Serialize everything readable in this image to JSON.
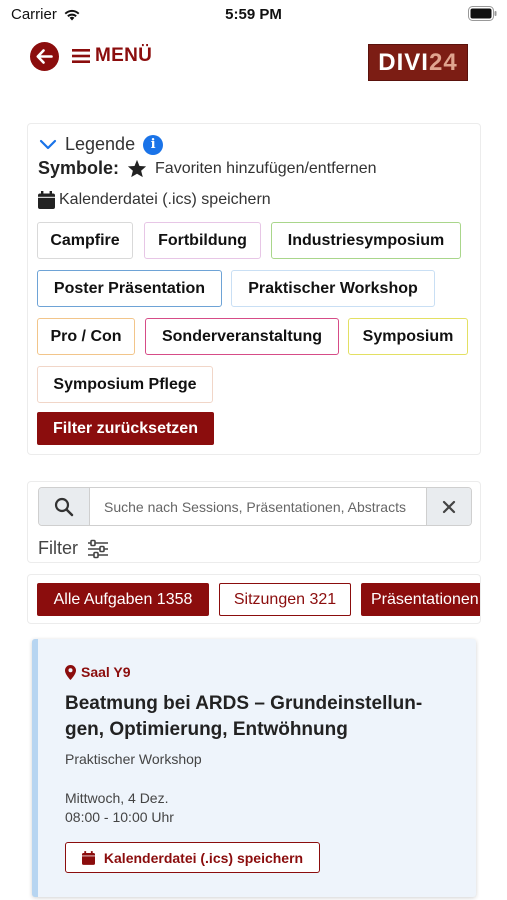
{
  "status_bar": {
    "carrier": "Carrier",
    "time": "5:59 PM"
  },
  "header": {
    "menu_label": "MENÜ",
    "logo_text_1": "DIVI",
    "logo_text_2": "24"
  },
  "legend": {
    "title": "Legende",
    "symbols_label": "Symbole:",
    "favorite_text": "Favoriten hinzufügen/entfernen",
    "calendar_text": "Kalenderdatei (.ics) speichern",
    "tags": [
      {
        "label": "Campfire",
        "color": "#d9d9d9"
      },
      {
        "label": "Fortbildung",
        "color": "#e7c6e6"
      },
      {
        "label": "Industriesymposium",
        "color": "#a9d68b"
      },
      {
        "label": "Poster Präsentation",
        "color": "#6ea3d6"
      },
      {
        "label": "Praktischer Workshop",
        "color": "#c9dff4"
      },
      {
        "label": "Pro / Con",
        "color": "#f2c58a"
      },
      {
        "label": "Sonderveranstaltung",
        "color": "#d64c87"
      },
      {
        "label": "Symposium",
        "color": "#e3e063"
      },
      {
        "label": "Symposium Pflege",
        "color": "#f1d6c8"
      }
    ],
    "reset_label": "Filter zurücksetzen"
  },
  "search": {
    "placeholder": "Suche nach Sessions, Präsentationen, Abstracts",
    "value": "",
    "filter_label": "Filter"
  },
  "tabs": [
    {
      "label": "Alle Aufgaben 1358",
      "active": true
    },
    {
      "label": "Sitzungen 321",
      "active": false
    },
    {
      "label": "Präsentationen",
      "active": true
    }
  ],
  "session": {
    "room": "Saal Y9",
    "title": "Beatmung bei ARDS – Grundeinstellun-gen, Optimierung, Entwöhnung",
    "type": "Praktischer Workshop",
    "day": "Mittwoch, 4 Dez.",
    "time": "08:00 - 10:00 Uhr",
    "ics_label": "Kalenderdatei (.ics) speichern"
  },
  "colors": {
    "brand": "#8b0d0d",
    "info": "#1a73e8",
    "card_bg": "#eef4fb",
    "card_border": "#b7d5f1"
  }
}
